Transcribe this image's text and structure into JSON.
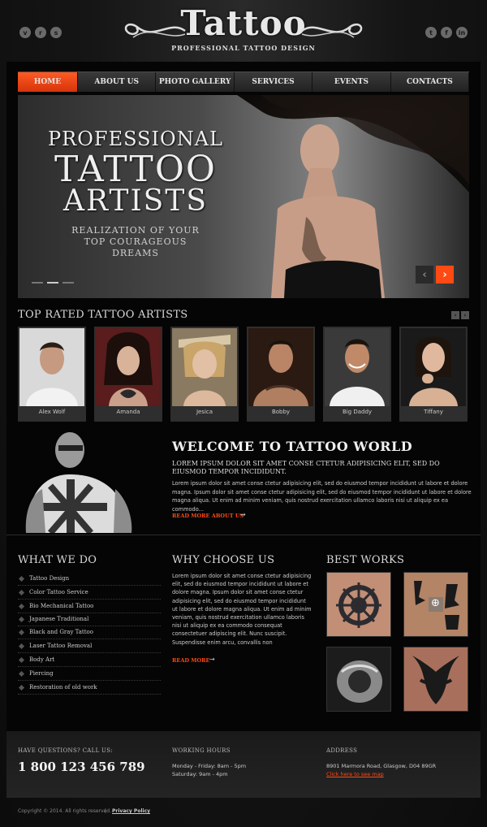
{
  "header": {
    "logo_title": "Tattoo",
    "logo_subtitle": "PROFESSIONAL TATTOO DESIGN",
    "social_left": [
      {
        "icon": "vimeo-icon",
        "glyph": "v"
      },
      {
        "icon": "rss-icon",
        "glyph": "r"
      },
      {
        "icon": "skype-icon",
        "glyph": "s"
      }
    ],
    "social_right": [
      {
        "icon": "twitter-icon",
        "glyph": "t"
      },
      {
        "icon": "facebook-icon",
        "glyph": "f"
      },
      {
        "icon": "linkedin-icon",
        "glyph": "in"
      }
    ]
  },
  "nav": {
    "items": [
      {
        "label": "HOME",
        "active": true
      },
      {
        "label": "ABOUT US"
      },
      {
        "label": "PHOTO GALLERY"
      },
      {
        "label": "SERVICES"
      },
      {
        "label": "EVENTS"
      },
      {
        "label": "CONTACTS"
      }
    ]
  },
  "hero": {
    "line1": "PROFESSIONAL",
    "line2": "TATTOO",
    "line3": "ARTISTS",
    "tag1": "REALIZATION OF YOUR",
    "tag2": "TOP COURAGEOUS",
    "tag3": "DREAMS",
    "slides": 3,
    "active_slide": 2
  },
  "artists": {
    "title": "TOP RATED TATTOO ARTISTS",
    "items": [
      "Alex Wolf",
      "Amanda",
      "Jesica",
      "Bobby",
      "Big Daddy",
      "Tiffany"
    ]
  },
  "welcome": {
    "title": "WELCOME TO TATTOO WORLD",
    "subtitle": "LOREM IPSUM DOLOR SIT AMET CONSE CTETUR ADIPISICING ELIT, SED DO EIUSMOD TEMPOR INCIDIDUNT.",
    "body": "Lorem ipsum dolor sit amet conse ctetur adipisicing elit, sed do eiusmod tempor incididunt ut labore et dolore magna. Ipsum dolor sit amet conse ctetur adipisicing elit, sed do eiusmod tempor incididunt ut labore et dolore magna aliqua. Ut enim ad minim veniam, quis nostrud exercitation ullamco laboris nisi ut aliquip ex ea commodo...",
    "read_more": "READ MORE ABOUT US",
    "arrow": "→"
  },
  "what_we_do": {
    "title": "WHAT WE DO",
    "items": [
      "Tattoo Design",
      "Color Tattoo Service",
      "Bio Mechanical Tattoo",
      "Japanese Traditional",
      "Black and Gray Tattoo",
      "Laser Tattoo Removal",
      "Body Art",
      "Piercing",
      "Restoration of old work"
    ]
  },
  "why_choose": {
    "title": "WHY CHOOSE US",
    "body": "Lorem ipsum dolor sit amet conse ctetur adipisicing elit, sed do eiusmod tempor incididunt ut labore et dolore magna. Ipsum dolor sit amet conse ctetur adipisicing elit, sed do eiusmod tempor incididunt ut labore et dolore magna aliqua. Ut enim ad minim veniam, quis nostrud exercitation ullamco laboris nisi ut aliquip ex ea commodo consequat consectetuer adipiscing elit. Nunc suscipit. Suspendisse enim arcu, convallis non",
    "read_more": "READ MORE",
    "arrow": "→"
  },
  "best_works": {
    "title": "BEST WORKS",
    "zoom_icon": "⊕"
  },
  "footer": {
    "questions_label": "HAVE QUESTIONS? CALL US:",
    "phone": "1 800 123 456 789",
    "hours_label": "WORKING HOURS",
    "hours_1": "Monday - Friday: 8am - 5pm",
    "hours_2": "Saturday: 9am - 4pm",
    "address_label": "ADDRESS",
    "address": "8901 Marmora Road, Glasgow, D04 89GR",
    "map_link": "Click here to see map",
    "copyright": "Copyright © 2014. All rights reserved.",
    "separator": "|",
    "privacy": "Privacy Policy"
  },
  "colors": {
    "accent": "#ff4a14",
    "background": "#050505",
    "text": "#cccccc"
  }
}
